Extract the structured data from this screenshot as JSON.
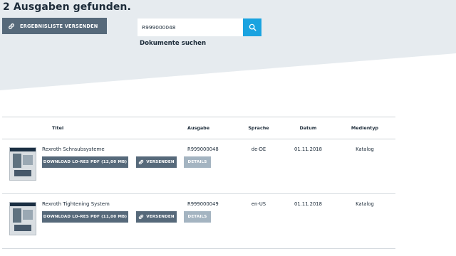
{
  "header": {
    "result_count": "2 Ausgaben gefunden.",
    "send_list_label": "ERGEBNISLISTE VERSENDEN",
    "search_value": "R999000048",
    "doc_search_label": "Dokumente suchen"
  },
  "table": {
    "columns": [
      "Titel",
      "Ausgabe",
      "Sprache",
      "Datum",
      "Medientyp"
    ],
    "rows": [
      {
        "title": "Rexroth Schraubsysteme",
        "download_label": "DOWNLOAD LO-RES PDF (12,00 MB)",
        "send_label": "VERSENDEN",
        "details_label": "DETAILS",
        "edition": "R999000048",
        "language": "de-DE",
        "date": "01.11.2018",
        "media_type": "Katalog"
      },
      {
        "title": "Rexroth Tightening System",
        "download_label": "DOWNLOAD LO-RES PDF (11,00 MB)",
        "send_label": "VERSENDEN",
        "details_label": "DETAILS",
        "edition": "R999000049",
        "language": "en-US",
        "date": "01.11.2018",
        "media_type": "Katalog"
      }
    ]
  },
  "icons": {
    "link": "link-icon",
    "search": "search-icon"
  },
  "colors": {
    "hero_bg": "#e6ebef",
    "button_dark": "#56697a",
    "button_disabled": "#a4b4c1",
    "search_accent": "#1aa3e0",
    "text_dark": "#1c2b39"
  }
}
